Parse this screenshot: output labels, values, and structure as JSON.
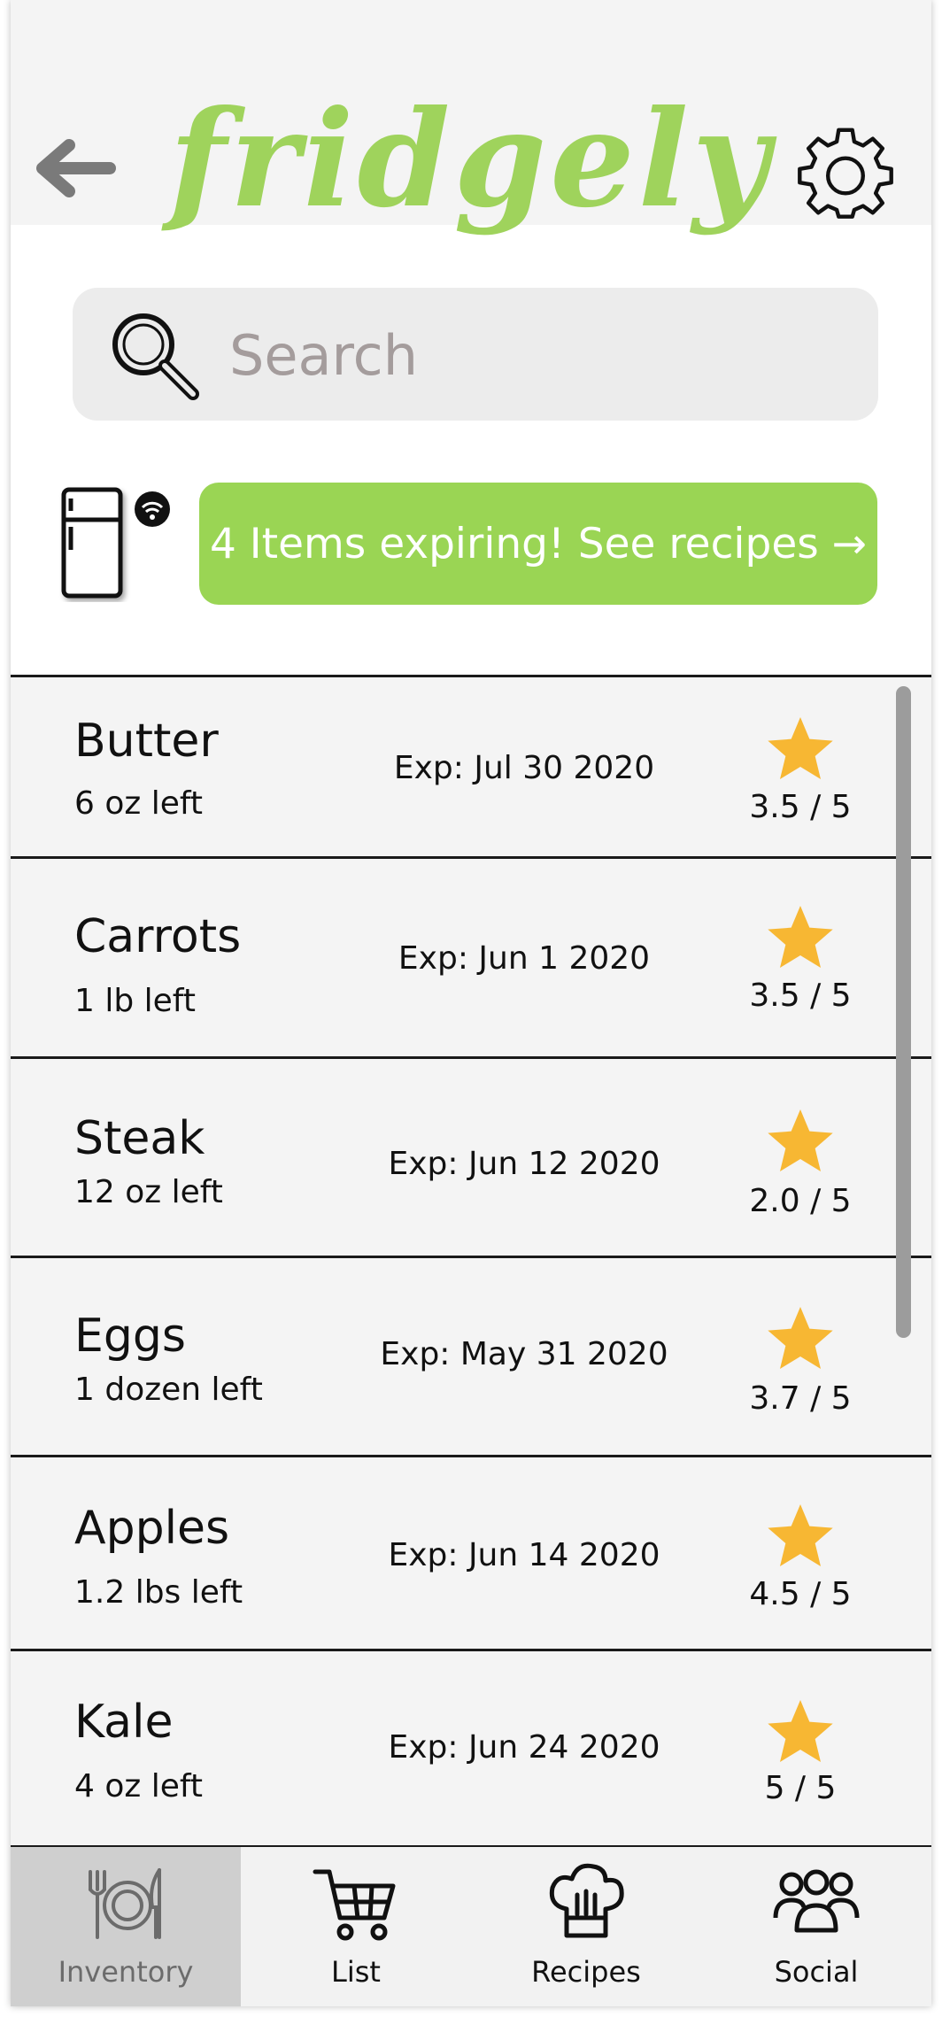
{
  "header": {
    "logo_text": "fridgely"
  },
  "search": {
    "placeholder": "Search",
    "value": ""
  },
  "alert": {
    "label": "4 Items expiring! See recipes →"
  },
  "items": [
    {
      "name": "Butter",
      "quantity": "6 oz left",
      "expiration": "Exp: Jul 30 2020",
      "rating": "3.5 / 5"
    },
    {
      "name": "Carrots",
      "quantity": "1 lb left",
      "expiration": "Exp: Jun 1 2020",
      "rating": "3.5 / 5"
    },
    {
      "name": "Steak",
      "quantity": "12 oz left",
      "expiration": "Exp: Jun 12 2020",
      "rating": "2.0 / 5"
    },
    {
      "name": "Eggs",
      "quantity": "1 dozen left",
      "expiration": "Exp: May 31 2020",
      "rating": "3.7 / 5"
    },
    {
      "name": "Apples",
      "quantity": "1.2 lbs left",
      "expiration": "Exp: Jun 14 2020",
      "rating": "4.5 / 5"
    },
    {
      "name": "Kale",
      "quantity": "4 oz left",
      "expiration": "Exp: Jun 24 2020",
      "rating": "5 / 5"
    }
  ],
  "tabs": [
    {
      "label": "Inventory",
      "icon": "plate-utensils-icon",
      "active": true
    },
    {
      "label": "List",
      "icon": "cart-icon",
      "active": false
    },
    {
      "label": "Recipes",
      "icon": "chef-hat-icon",
      "active": false
    },
    {
      "label": "Social",
      "icon": "people-icon",
      "active": false
    }
  ],
  "colors": {
    "accent": "#9ad554",
    "logo": "#9fd35c",
    "star": "#f7b733",
    "active_tab": "#cfcfcf"
  }
}
